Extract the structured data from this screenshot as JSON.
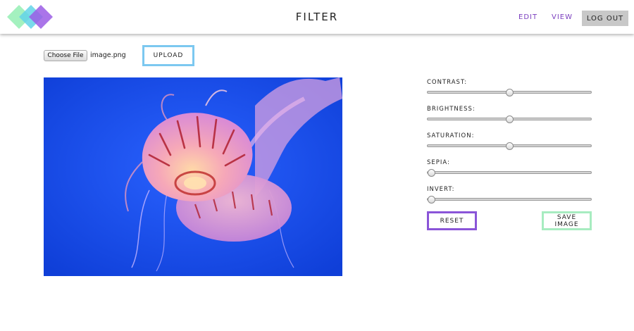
{
  "header": {
    "title": "FILTER",
    "nav": {
      "edit_label": "EDIT",
      "view_label": "VIEW"
    },
    "logout_label": "LOG OUT",
    "logo_colors": [
      "#9af0b8",
      "#63d3e8",
      "#9b5de5"
    ]
  },
  "upload": {
    "choose_file_label": "Choose File",
    "file_name": "image.png",
    "upload_label": "UPLOAD",
    "upload_border_color": "#7cc8f0"
  },
  "image": {
    "subject": "jellyfish",
    "background_color": "#1a4ff0"
  },
  "filters": [
    {
      "label": "CONTRAST:",
      "value": 0.5
    },
    {
      "label": "BRIGHTNESS:",
      "value": 0.5
    },
    {
      "label": "SATURATION:",
      "value": 0.5
    },
    {
      "label": "SEPIA:",
      "value": 0.0
    },
    {
      "label": "INVERT:",
      "value": 0.0
    }
  ],
  "actions": {
    "reset_label": "RESET",
    "save_label": "SAVE IMAGE",
    "reset_border_color": "#8a55d8",
    "save_border_color": "#a7ecc0"
  },
  "accent_color": "#7b3fbf"
}
